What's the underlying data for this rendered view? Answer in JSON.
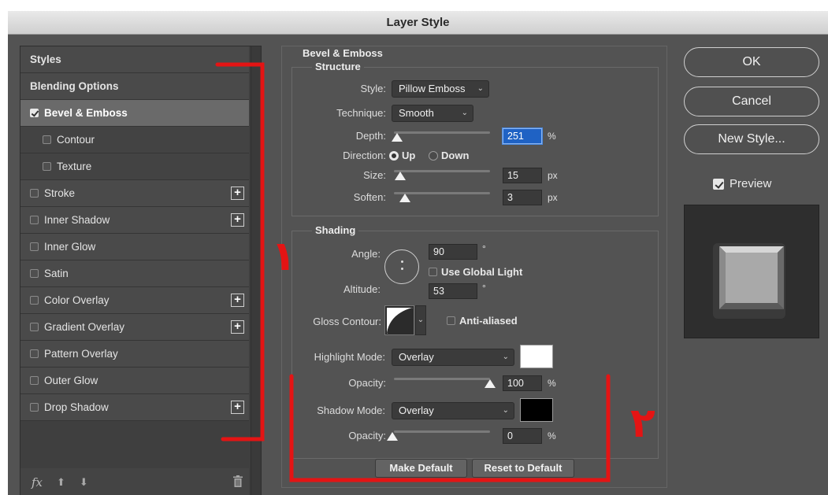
{
  "window": {
    "title": "Layer Style"
  },
  "styles_list": {
    "header": "Styles",
    "items": [
      {
        "label": "Blending Options",
        "checkbox": false,
        "checked": false,
        "plus": false,
        "sub": false,
        "selected": false
      },
      {
        "label": "Bevel & Emboss",
        "checkbox": true,
        "checked": true,
        "plus": false,
        "sub": false,
        "selected": true
      },
      {
        "label": "Contour",
        "checkbox": true,
        "checked": false,
        "plus": false,
        "sub": true,
        "selected": false
      },
      {
        "label": "Texture",
        "checkbox": true,
        "checked": false,
        "plus": false,
        "sub": true,
        "selected": false
      },
      {
        "label": "Stroke",
        "checkbox": true,
        "checked": false,
        "plus": true,
        "sub": false,
        "selected": false
      },
      {
        "label": "Inner Shadow",
        "checkbox": true,
        "checked": false,
        "plus": true,
        "sub": false,
        "selected": false
      },
      {
        "label": "Inner Glow",
        "checkbox": true,
        "checked": false,
        "plus": false,
        "sub": false,
        "selected": false
      },
      {
        "label": "Satin",
        "checkbox": true,
        "checked": false,
        "plus": false,
        "sub": false,
        "selected": false
      },
      {
        "label": "Color Overlay",
        "checkbox": true,
        "checked": false,
        "plus": true,
        "sub": false,
        "selected": false
      },
      {
        "label": "Gradient Overlay",
        "checkbox": true,
        "checked": false,
        "plus": true,
        "sub": false,
        "selected": false
      },
      {
        "label": "Pattern Overlay",
        "checkbox": true,
        "checked": false,
        "plus": false,
        "sub": false,
        "selected": false
      },
      {
        "label": "Outer Glow",
        "checkbox": true,
        "checked": false,
        "plus": false,
        "sub": false,
        "selected": false
      },
      {
        "label": "Drop Shadow",
        "checkbox": true,
        "checked": false,
        "plus": true,
        "sub": false,
        "selected": false
      }
    ],
    "footer": {
      "fx": "fx",
      "up_icon": "arrow-up-icon",
      "down_icon": "arrow-down-icon",
      "trash_icon": "trash-icon"
    }
  },
  "bevel_emboss": {
    "title": "Bevel & Emboss",
    "structure": {
      "title": "Structure",
      "style_label": "Style:",
      "style_value": "Pillow Emboss",
      "technique_label": "Technique:",
      "technique_value": "Smooth",
      "depth_label": "Depth:",
      "depth_value": "251",
      "depth_unit": "%",
      "direction_label": "Direction:",
      "direction_up": "Up",
      "direction_down": "Down",
      "direction_selected": "Up",
      "size_label": "Size:",
      "size_value": "15",
      "size_unit": "px",
      "soften_label": "Soften:",
      "soften_value": "3",
      "soften_unit": "px"
    },
    "shading": {
      "title": "Shading",
      "angle_label": "Angle:",
      "angle_value": "90",
      "angle_unit": "°",
      "use_global_light": "Use Global Light",
      "altitude_label": "Altitude:",
      "altitude_value": "53",
      "altitude_unit": "°",
      "gloss_contour_label": "Gloss Contour:",
      "anti_aliased": "Anti-aliased",
      "highlight_mode_label": "Highlight Mode:",
      "highlight_mode_value": "Overlay",
      "highlight_color": "#ffffff",
      "highlight_opacity_label": "Opacity:",
      "highlight_opacity_value": "100",
      "highlight_opacity_unit": "%",
      "shadow_mode_label": "Shadow Mode:",
      "shadow_mode_value": "Overlay",
      "shadow_color": "#000000",
      "shadow_opacity_label": "Opacity:",
      "shadow_opacity_value": "0",
      "shadow_opacity_unit": "%"
    },
    "buttons": {
      "make_default": "Make Default",
      "reset_default": "Reset to Default"
    }
  },
  "actions": {
    "ok": "OK",
    "cancel": "Cancel",
    "new_style": "New Style...",
    "preview_label": "Preview",
    "preview_checked": true
  },
  "annotations": {
    "color": "#e41414",
    "label_1": "١",
    "label_2": "٢"
  }
}
